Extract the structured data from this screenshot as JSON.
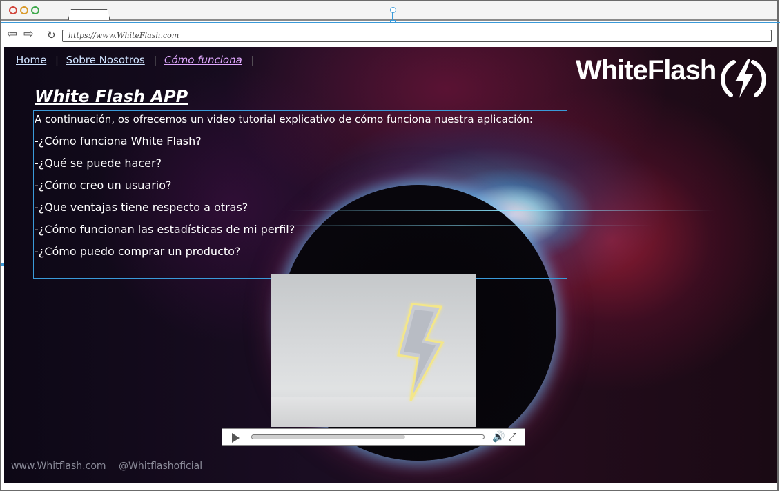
{
  "browser": {
    "url": "https://www.WhiteFlash.com"
  },
  "nav": {
    "home": "Home",
    "about": "Sobre Nosotros",
    "how": "Cómo funciona",
    "separator": "|"
  },
  "brand": {
    "name": "WhiteFlash",
    "logo_icon": "lightning-bolt-circle-icon"
  },
  "content": {
    "title": "White Flash APP",
    "intro": "A continuación, os ofrecemos un video tutorial explicativo de cómo funciona nuestra aplicación:",
    "questions": [
      "-¿Cómo funciona White Flash?",
      "-¿Qué se puede hacer?",
      "-¿Cómo creo un usuario?",
      "-¿Que ventajas tiene respecto a otras?",
      "-¿Cómo funcionan las estadísticas de mi perfil?",
      "-¿Cómo puedo comprar un producto?"
    ]
  },
  "video": {
    "progress": 0.66,
    "play_icon": "play-icon",
    "volume_icon": "volume-icon",
    "fullscreen_icon": "fullscreen-icon"
  },
  "footer": {
    "website": "www.Whitflash.com",
    "social": "@Whitflashoficial"
  },
  "colors": {
    "accent_link": "#e0a8ff",
    "guide": "#3a9ad9"
  }
}
